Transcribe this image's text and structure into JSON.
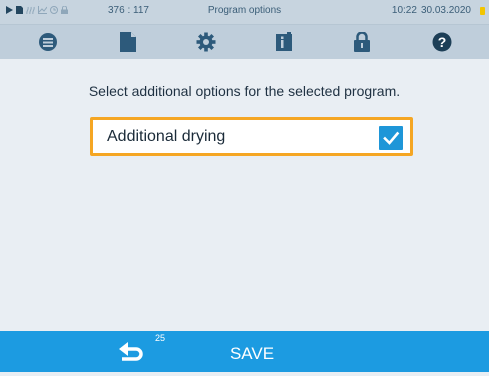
{
  "status_bar": {
    "counter": "376 : 117",
    "title": "Program options",
    "time": "10:22",
    "date": "30.03.2020",
    "icons": [
      "play-icon",
      "document-icon",
      "steam-icon",
      "chart-icon",
      "clock-icon",
      "lock-icon"
    ]
  },
  "toolbar": {
    "icons": [
      "list-icon",
      "document-icon",
      "gear-icon",
      "info-book-icon",
      "lock-icon",
      "help-icon"
    ],
    "help_symbol": "?"
  },
  "main": {
    "prompt": "Select additional options for the selected program.",
    "options": [
      {
        "label": "Additional drying",
        "checked": true
      }
    ]
  },
  "footer": {
    "back_count": "25",
    "save_label": "SAVE"
  },
  "colors": {
    "accent_blue": "#1c9be1",
    "highlight_orange": "#f5a623",
    "header_bg": "#bfcedb",
    "content_bg": "#e9eef3"
  }
}
